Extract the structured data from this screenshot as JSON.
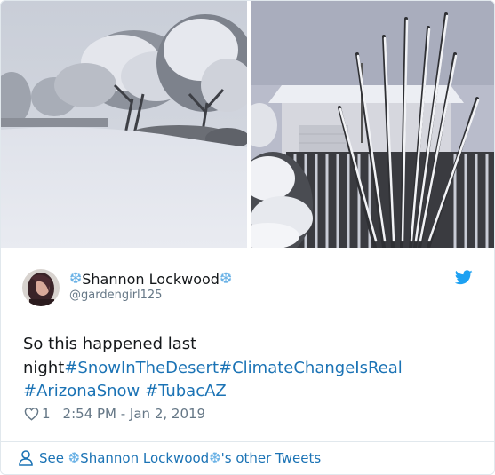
{
  "tweet": {
    "author": {
      "name_prefix_icon": "snowflake-icon",
      "name": "Shannon Lockwood",
      "name_suffix_icon": "snowflake-icon",
      "handle": "@gardengirl125",
      "flake": "❆"
    },
    "text": {
      "plain": "So this happened last night",
      "hashtags": [
        "#SnowInTheDesert",
        "#ClimateChangeIsReal",
        "#ArizonaSnow",
        "#TubacAZ"
      ],
      "space": " "
    },
    "likes": "1",
    "timestamp": "2:54 PM - Jan 2, 2019",
    "footer": {
      "see": "See",
      "name": "Shannon Lockwood",
      "suffix": "'s other Tweets"
    },
    "icons": {
      "brand": "twitter-bird-icon",
      "like": "heart-icon",
      "profile": "person-icon"
    },
    "colors": {
      "link": "#1b73b5",
      "snowflake": "#6ab2e6",
      "muted": "#657786",
      "twitter_blue": "#1da1f2"
    }
  }
}
